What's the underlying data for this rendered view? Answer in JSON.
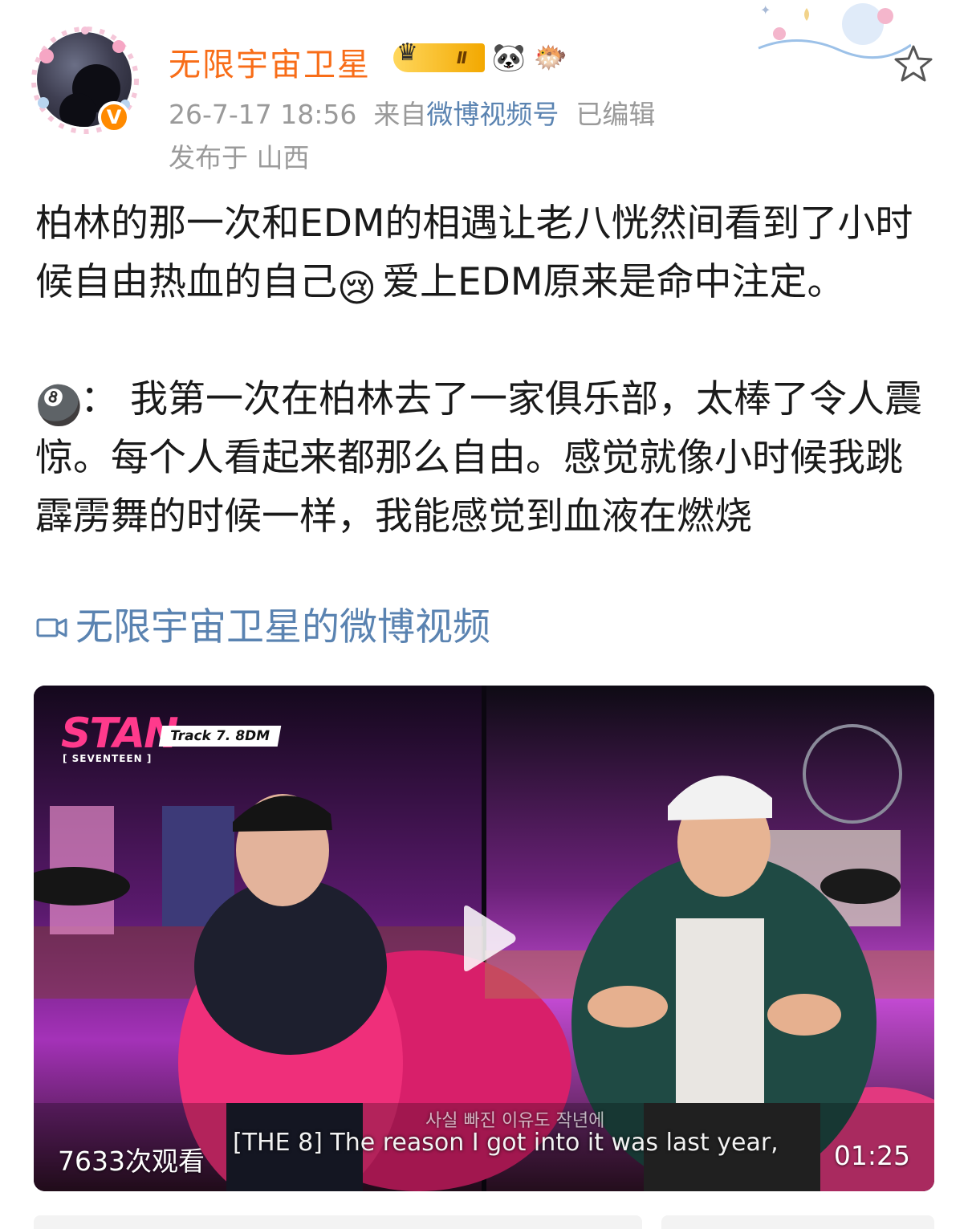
{
  "user": {
    "name": "无限宇宙卫星",
    "level_badge": "Ⅱ",
    "emoji_badges": [
      "🐼",
      "🐡"
    ],
    "verified_mark": "V"
  },
  "meta": {
    "timestamp": "26-7-17 18:56",
    "source_prefix": "来自",
    "source": "微博视频号",
    "edited": "已编辑",
    "location": "发布于 山西"
  },
  "post": {
    "paragraph1_a": "柏林的那一次和EDM的相遇让老八恍然间看到了小时候自由热血的自己",
    "paragraph1_emoji": "😢",
    "paragraph1_b": "爱上EDM原来是命中注定。",
    "paragraph2_emoji": "🎱",
    "paragraph2": "： 我第一次在柏林去了一家俱乐部，太棒了令人震惊。每个人看起来都那么自由。感觉就像小时候我跳霹雳舞的时候一样，我能感觉到血液在燃烧",
    "video_link": "无限宇宙卫星的微博视频"
  },
  "video": {
    "logo": "STAN",
    "track": "Track 7. 8DM",
    "group": "[ SEVENTEEN ]",
    "views": "7633次观看",
    "subtitle_en": "[THE 8] The reason I got into it was last year,",
    "subtitle_kr": "사실 빠진 이유도 작년에",
    "duration": "01:25"
  },
  "colors": {
    "username": "#f86d18",
    "link": "#5a83b1",
    "meta": "#9a9a9a"
  }
}
